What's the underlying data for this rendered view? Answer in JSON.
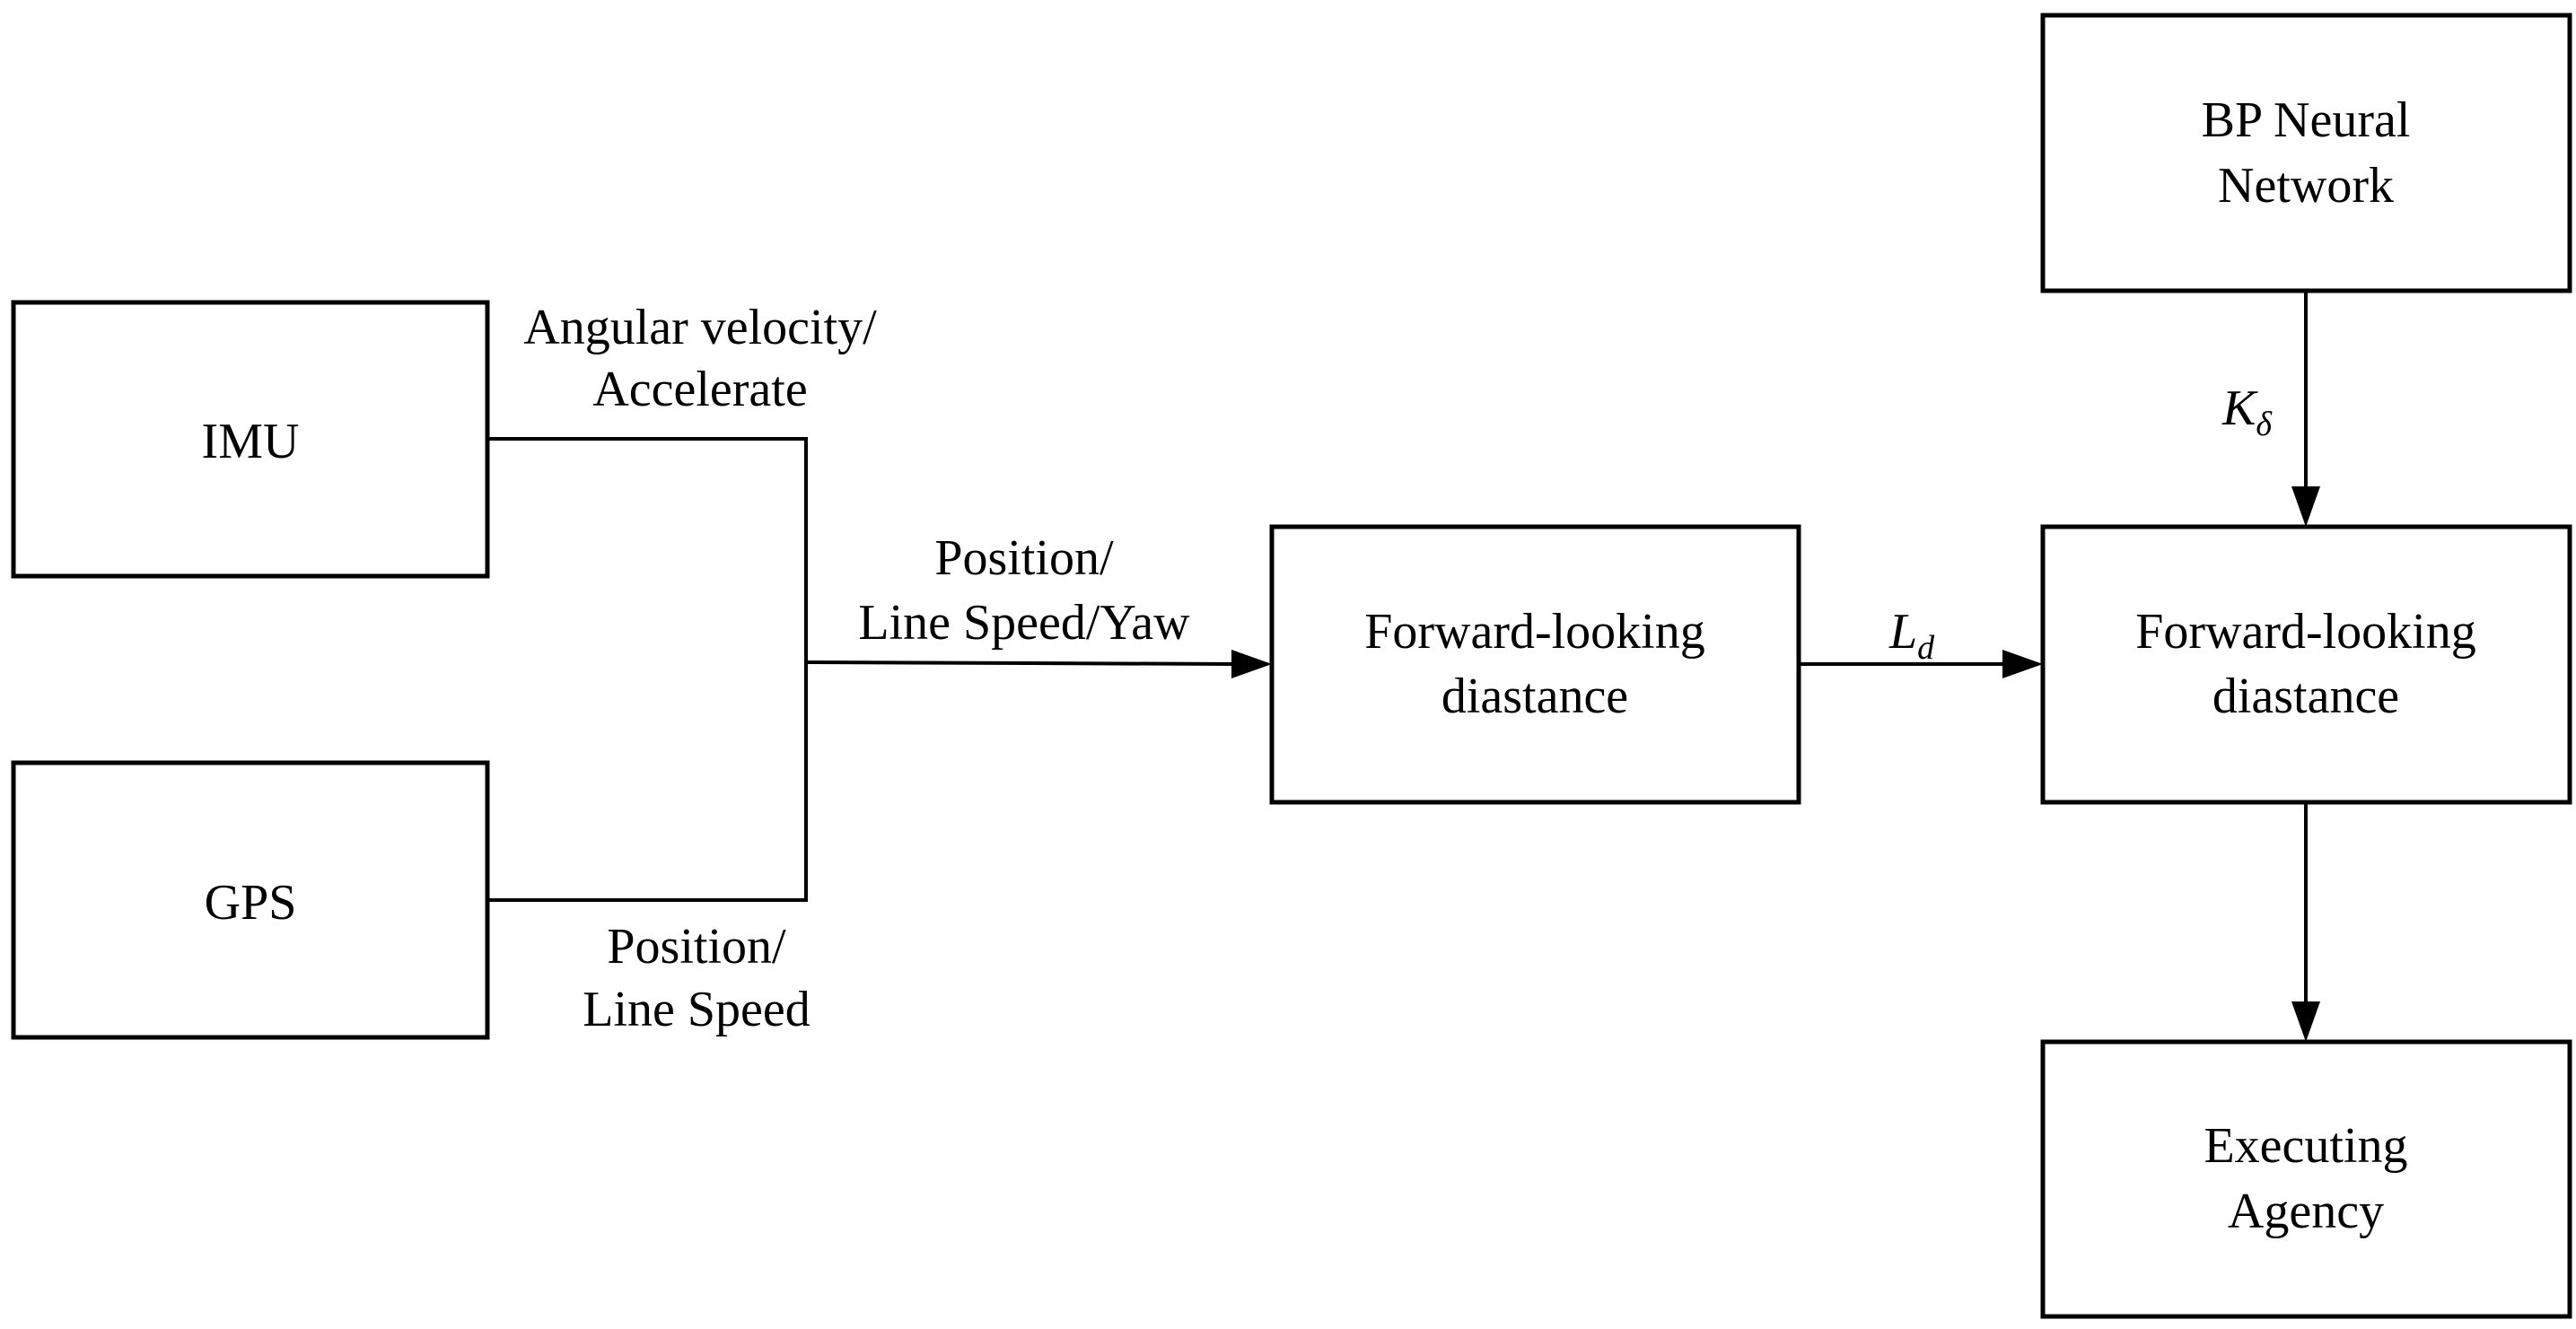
{
  "diagram": {
    "nodes": {
      "imu": {
        "line1": "IMU"
      },
      "gps": {
        "line1": "GPS"
      },
      "fld1": {
        "line1": "Forward-looking",
        "line2": "diastance"
      },
      "fld2": {
        "line1": "Forward-looking",
        "line2": "diastance"
      },
      "bp": {
        "line1": "BP Neural",
        "line2": "Network"
      },
      "exec": {
        "line1": "Executing",
        "line2": "Agency"
      }
    },
    "edges": {
      "imu_out": {
        "line1": "Angular velocity/",
        "line2": "Accelerate"
      },
      "gps_out": {
        "line1": "Position/",
        "line2": "Line Speed"
      },
      "merged": {
        "line1": "Position/",
        "line2": "Line Speed/Yaw"
      },
      "ld": {
        "main": "L",
        "sub": "d"
      },
      "k": {
        "main": "K",
        "sub": "δ"
      }
    }
  }
}
